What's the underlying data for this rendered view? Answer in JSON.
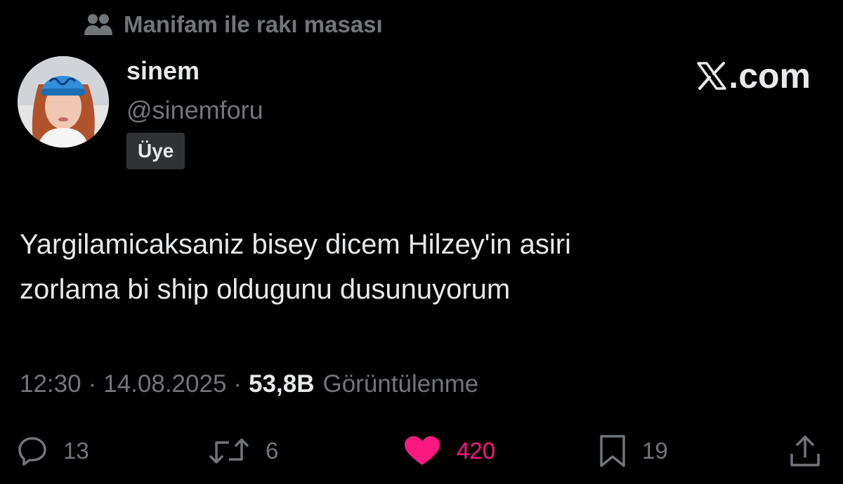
{
  "community": {
    "icon": "people-icon",
    "name": "Manifam ile rakı masası"
  },
  "author": {
    "display_name": "sinem",
    "handle": "@sinemforu",
    "badge": "Üye"
  },
  "brand": {
    "icon": "x-logo-icon",
    "text": ".com"
  },
  "tweet": {
    "text_line_1": "Yargilamicaksaniz bisey dicem Hilzey'in asiri",
    "text_line_2": "zorlama bi ship oldugunu dusunuyorum"
  },
  "meta": {
    "time": "12:30",
    "separator": "·",
    "date": "14.08.2025",
    "views_count": "53,8B",
    "views_label": "Görüntülenme"
  },
  "actions": {
    "reply": {
      "icon": "reply-icon",
      "count": "13"
    },
    "retweet": {
      "icon": "retweet-icon",
      "count": "6"
    },
    "like": {
      "icon": "heart-icon",
      "count": "420",
      "liked": true
    },
    "bookmark": {
      "icon": "bookmark-icon",
      "count": "19"
    },
    "share": {
      "icon": "share-icon"
    }
  },
  "colors": {
    "background": "#000000",
    "primary_text": "#e7e9ea",
    "secondary_text": "#71767b",
    "like_accent": "#f91880",
    "badge_bg": "#2f3336"
  }
}
